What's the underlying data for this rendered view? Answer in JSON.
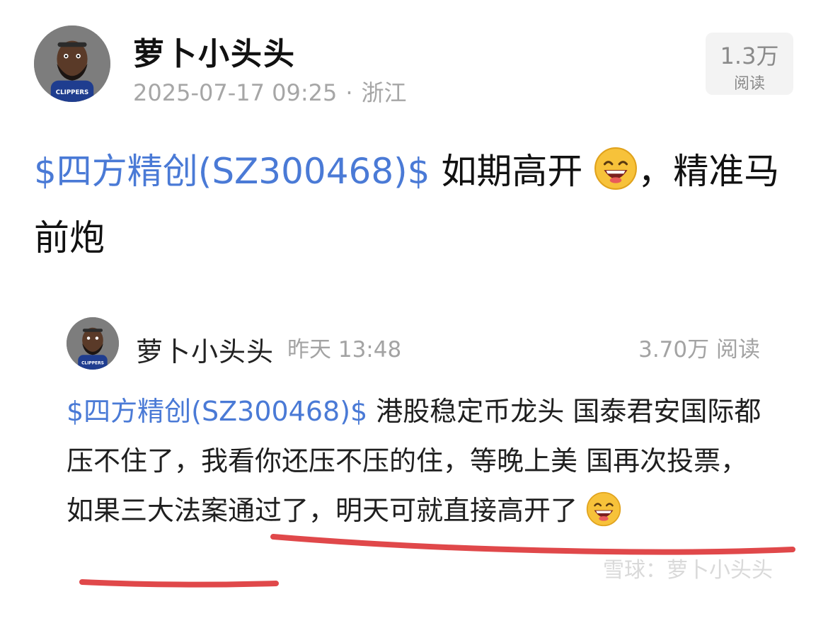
{
  "post": {
    "author": "萝卜小头头",
    "date": "2025-07-17 09:25",
    "separator": "·",
    "location": "浙江",
    "reads_count": "1.3万",
    "reads_label": "阅读",
    "stock_tag": "$四方精创(SZ300468)$",
    "text_part1": " 如期高开",
    "text_part2": "，精准马前炮"
  },
  "quote": {
    "author": "萝卜小头头",
    "time": "昨天 13:48",
    "reads": "3.70万 阅读",
    "stock_tag": "$四方精创(SZ300468)$",
    "text": " 港股稳定币龙头 国泰君安国际都压不住了，我看你还压不压的住，等晚上美 国再次投票，如果三大法案通过了，明天可就直接高开了",
    "watermark": "雪球：萝卜小头头"
  },
  "colors": {
    "stock_link": "#4a7ad6",
    "underline": "#e0484a",
    "meta_gray": "#a6a6a6"
  },
  "icons": {
    "avatar": "player-avatar",
    "emoji": "laughing-emoji"
  }
}
